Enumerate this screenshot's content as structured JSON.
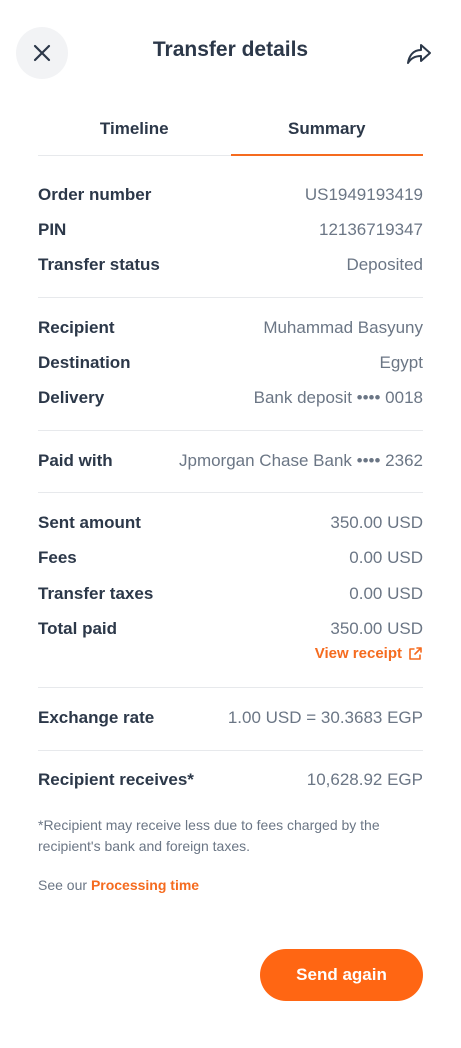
{
  "header": {
    "title": "Transfer details",
    "close_icon": "close-icon",
    "share_icon": "share-icon"
  },
  "tabs": [
    {
      "label": "Timeline",
      "active": false
    },
    {
      "label": "Summary",
      "active": true
    }
  ],
  "order": {
    "order_number_label": "Order number",
    "order_number_value": "US1949193419",
    "pin_label": "PIN",
    "pin_value": "12136719347",
    "status_label": "Transfer status",
    "status_value": "Deposited"
  },
  "recipient": {
    "recipient_label": "Recipient",
    "recipient_value": "Muhammad Basyuny",
    "destination_label": "Destination",
    "destination_value": "Egypt",
    "delivery_label": "Delivery",
    "delivery_value": "Bank deposit •••• 0018"
  },
  "payment": {
    "paid_with_label": "Paid with",
    "paid_with_value": "Jpmorgan Chase Bank •••• 2362"
  },
  "amounts": {
    "sent_label": "Sent amount",
    "sent_value": "350.00 USD",
    "fees_label": "Fees",
    "fees_value": "0.00 USD",
    "taxes_label": "Transfer taxes",
    "taxes_value": "0.00 USD",
    "total_label": "Total paid",
    "total_value": "350.00 USD",
    "receipt_link": "View receipt"
  },
  "exchange": {
    "label": "Exchange rate",
    "value": "1.00 USD = 30.3683 EGP"
  },
  "receives": {
    "label": "Recipient receives*",
    "value": "10,628.92 EGP"
  },
  "footnote": {
    "note": "*Recipient may receive less due to fees charged by the recipient's bank and foreign taxes.",
    "see_our": "See our",
    "processing_link": "Processing time"
  },
  "actions": {
    "send_again": "Send again"
  },
  "colors": {
    "accent": "#f56b1f",
    "button": "#ff6613",
    "text_dark": "#2c3849",
    "text_muted": "#6b7685"
  }
}
